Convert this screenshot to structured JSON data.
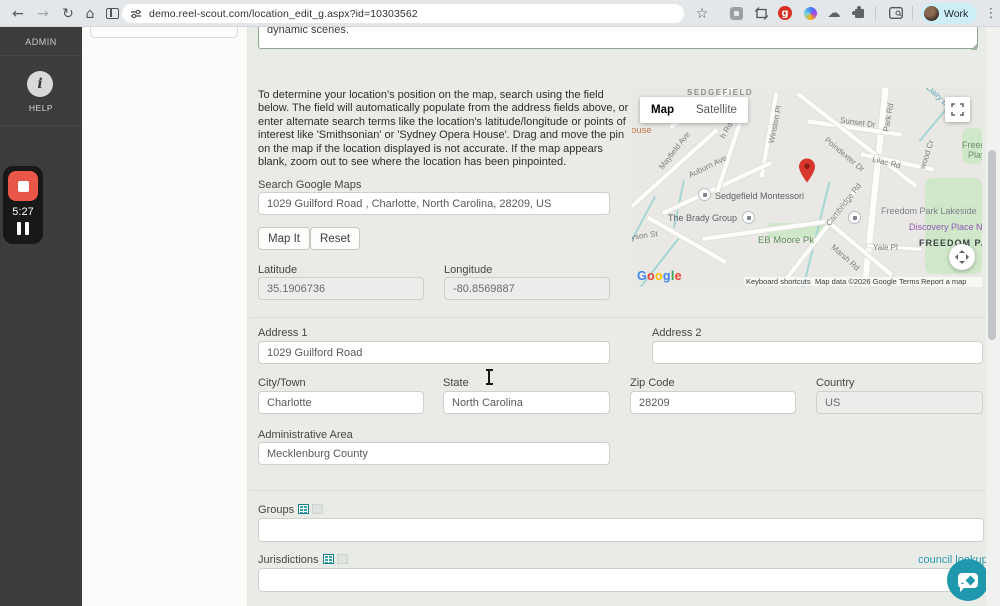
{
  "colors": {
    "accent_teal": "#2a9bad",
    "record_red": "#ea5648",
    "pin_red": "#d7372c"
  },
  "browser": {
    "url": "demo.reel-scout.com/location_edit_g.aspx?id=10303562",
    "profile": "Work",
    "extension_badge_letter": "g"
  },
  "sidebar": {
    "admin": "ADMIN",
    "help": "HELP",
    "recorder_time": "5:27"
  },
  "page": {
    "description_value": "dynamic scenes.",
    "map_instructions": "To determine your location's position on the map, search using the field below. The field will automatically populate from the address fields above, or enter alternate search terms like the location's latitude/longitude or points of interest like 'Smithsonian' or 'Sydney Opera House'. Drag and move the pin on the map if the location displayed is not accurate. If the map appears blank, zoom out to see where the location has been pinpointed.",
    "search": {
      "label": "Search Google Maps",
      "value": "1029 Guilford Road , Charlotte, North Carolina, 28209, US"
    },
    "buttons": {
      "map_it": "Map It",
      "reset": "Reset"
    },
    "fields": {
      "latitude": {
        "label": "Latitude",
        "value": "35.1906736"
      },
      "longitude": {
        "label": "Longitude",
        "value": "-80.8569887"
      },
      "address1": {
        "label": "Address 1",
        "value": "1029 Guilford Road"
      },
      "address2": {
        "label": "Address 2",
        "value": ""
      },
      "city": {
        "label": "City/Town",
        "value": "Charlotte"
      },
      "state": {
        "label": "State",
        "value": "North Carolina"
      },
      "zip": {
        "label": "Zip Code",
        "value": "28209"
      },
      "country": {
        "label": "Country",
        "value": "US"
      },
      "admin_area": {
        "label": "Administrative Area",
        "value": "Mecklenburg County"
      }
    },
    "groups": {
      "label": "Groups",
      "value": ""
    },
    "jurisdictions": {
      "label": "Jurisdictions",
      "value": "",
      "lookup_link": "council lookup"
    }
  },
  "map": {
    "type_controls": {
      "map": "Map",
      "satellite": "Satellite"
    },
    "google_letters": [
      "G",
      "o",
      "o",
      "g",
      "l",
      "e"
    ],
    "attribution": [
      "Keyboard shortcuts",
      "Map data ©2026 Google",
      "Terms",
      "Report a map error"
    ],
    "labels": {
      "sedgefield": "SEDGEFIELD",
      "ouse": "ouse",
      "mayfield": "Mayfield Ave",
      "h_rd": "h Rd",
      "winston": "Winston Pl",
      "auburn": "Auburn Ave",
      "sunset": "Sunset Dr",
      "park_rd": "Park Rd",
      "poindexter": "Poindexter Dr",
      "lilac": "Lilac Rd",
      "wood_cr": "wood Cr",
      "dairy": "Dairy Br",
      "freedo": "Freedo",
      "play": "Play",
      "montessori": "Sedgefield Montessori",
      "brady": "The Brady Group",
      "cambridge": "Cambridge Rd",
      "lakeside": "Freedom Park Lakeside",
      "discovery": "Discovery Place N",
      "freedom_park": "FREEDOM PA",
      "eb_moore": "EB Moore Pk",
      "yale": "Yale Pl",
      "marsh": "Marsh Rd",
      "yson": "yson St"
    }
  }
}
